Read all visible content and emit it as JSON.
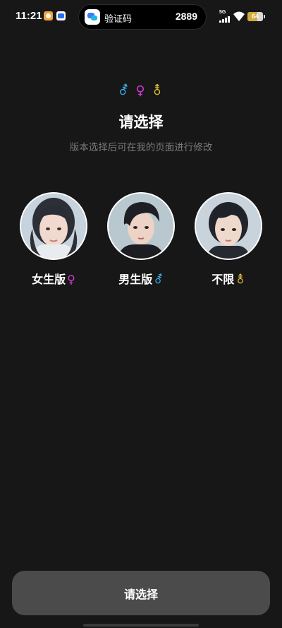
{
  "status_bar": {
    "time": "11:21",
    "network": "5G",
    "battery": "64",
    "battery_level": 0.64
  },
  "notification": {
    "label": "验证码",
    "code": "2889"
  },
  "header": {
    "symbols": [
      "⚦",
      "♀",
      "⚨"
    ],
    "title": "请选择",
    "subtitle": "版本选择后可在我的页面进行修改"
  },
  "options": [
    {
      "label": "女生版",
      "symbol": "♀",
      "symbol_color": "#d63bd6"
    },
    {
      "label": "男生版",
      "symbol": "⚦",
      "symbol_color": "#3ab4e8"
    },
    {
      "label": "不限",
      "symbol": "⚨",
      "symbol_color": "#e8c53a"
    }
  ],
  "colors": {
    "background": "#171717",
    "button": "#4b4b4b",
    "subtitle": "#7a7a7a"
  },
  "bottom_button": {
    "label": "请选择"
  }
}
